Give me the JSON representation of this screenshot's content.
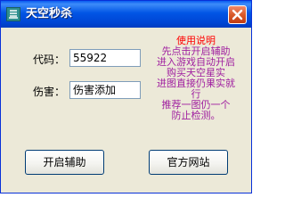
{
  "window": {
    "title": "天空秒杀",
    "icon": "app-icon",
    "close_icon": "close-icon"
  },
  "form": {
    "code_label": "代码：",
    "code_value": "55922",
    "damage_label": "伤害：",
    "damage_value": "伤害添加"
  },
  "instructions": {
    "heading": "使用说明",
    "lines": [
      "先点击开启辅助",
      "进入游戏自动开启",
      "购买天空星实",
      "进图直接仍果实就",
      "行",
      "推荐一图仍一个",
      "防止检测。"
    ]
  },
  "buttons": {
    "start_label": "开启辅助",
    "website_label": "官方网站"
  },
  "colors": {
    "titlebar": "#0155e5",
    "heading_red": "#ff0000",
    "instructions_purple": "#a020a0",
    "window_bg": "#ece9d8"
  }
}
